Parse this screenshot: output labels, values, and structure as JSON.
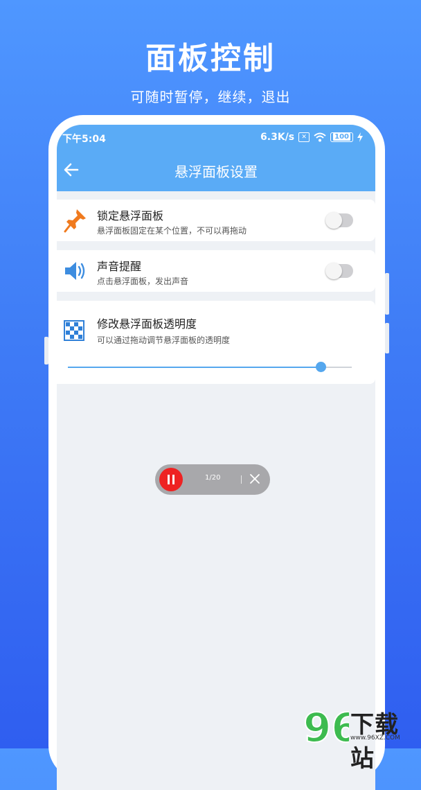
{
  "promo": {
    "title": "面板控制",
    "subtitle": "可随时暂停，继续，退出"
  },
  "status_bar": {
    "time": "下午5:04",
    "speed": "6.3K/s",
    "battery": "100"
  },
  "toolbar": {
    "title": "悬浮面板设置"
  },
  "settings": [
    {
      "title": "锁定悬浮面板",
      "desc": "悬浮面板固定在某个位置，不可以再拖动",
      "icon": "pin-icon",
      "enabled": false
    },
    {
      "title": "声音提醒",
      "desc": "点击悬浮面板，发出声音",
      "icon": "speaker-icon",
      "enabled": false
    },
    {
      "title": "修改悬浮面板透明度",
      "desc": "可以通过拖动调节悬浮面板的透明度",
      "icon": "checkerboard-icon",
      "opacity_value": 0.89
    }
  ],
  "float_panel": {
    "count": "1/20"
  },
  "watermark": {
    "logo": "96",
    "text": "下载站",
    "url": "www.96XZ.COM"
  },
  "colors": {
    "background_top": "#4f97ff",
    "background_bottom": "#2f5ef0",
    "header": "#5aabf6",
    "accent": "#55a7ee",
    "pause": "#ee2222",
    "pin": "#f07a1e",
    "speaker": "#3d8de0"
  }
}
